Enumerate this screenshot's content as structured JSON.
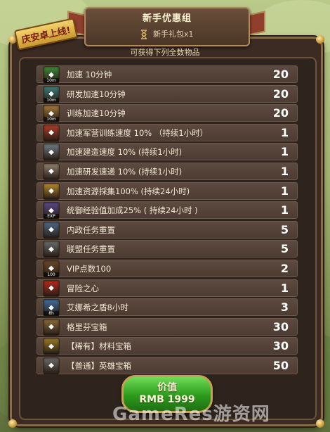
{
  "banner": {
    "title": "新手优惠组",
    "pack_label": "新手礼包x1"
  },
  "badge": "庆安卓上线!",
  "caption": "可获得下列全数物品",
  "items": [
    {
      "name": "加速 10分钟",
      "qty": "20",
      "icon": "speedup-icon",
      "icon_text": "10m",
      "color": "#3f8a3a"
    },
    {
      "name": "研发加速10分钟",
      "qty": "20",
      "icon": "research-speedup-icon",
      "icon_text": "10m",
      "color": "#3a7f7a"
    },
    {
      "name": "训练加速10分钟",
      "qty": "20",
      "icon": "training-speedup-icon",
      "icon_text": "10m",
      "color": "#a67a3a"
    },
    {
      "name": "加速军营训练速度 10% （持续1小时）",
      "qty": "1",
      "icon": "barracks-boost-icon",
      "icon_text": "",
      "color": "#b23b2c"
    },
    {
      "name": "加速建造速度  10%   (持续1小时)",
      "qty": "1",
      "icon": "build-boost-icon",
      "icon_text": "",
      "color": "#6f7d88"
    },
    {
      "name": "加速研发速递  10%   (持续1小时)",
      "qty": "1",
      "icon": "research-boost-icon",
      "icon_text": "",
      "color": "#8e8270"
    },
    {
      "name": "加速资源採集100%  (持续24小时)",
      "qty": "1",
      "icon": "gather-boost-icon",
      "icon_text": "",
      "color": "#b58a2f"
    },
    {
      "name": "统御经验值加成25% ( 持续24小时 )",
      "qty": "1",
      "icon": "exp-boost-icon",
      "icon_text": "EXP",
      "color": "#5a4a8a"
    },
    {
      "name": "内政任务重置",
      "qty": "5",
      "icon": "domestic-quest-reset-icon",
      "icon_text": "",
      "color": "#4d6a8a"
    },
    {
      "name": "联盟任务重置",
      "qty": "5",
      "icon": "alliance-quest-reset-icon",
      "icon_text": "",
      "color": "#6b6b6b"
    },
    {
      "name": "VIP点数100",
      "qty": "2",
      "icon": "vip-points-icon",
      "icon_text": "100",
      "color": "#6a4a28"
    },
    {
      "name": "冒险之心",
      "qty": "1",
      "icon": "heart-icon",
      "icon_text": "",
      "color": "#b8281c"
    },
    {
      "name": "艾娜希之盾8小时",
      "qty": "3",
      "icon": "shield-icon",
      "icon_text": "8h",
      "color": "#3e6ea0"
    },
    {
      "name": "格里芬宝箱",
      "qty": "30",
      "icon": "griffin-chest-icon",
      "icon_text": "",
      "color": "#8a6a3a"
    },
    {
      "name": "【稀有】材料宝箱",
      "qty": "30",
      "icon": "material-chest-icon",
      "icon_text": "",
      "color": "#9a7a2a"
    },
    {
      "name": "【普通】英雄宝箱",
      "qty": "50",
      "icon": "hero-chest-icon",
      "icon_text": "",
      "color": "#6a6a6a"
    }
  ],
  "price": {
    "label": "价值",
    "value": "RMB 1999"
  },
  "watermark": "GameRes游资网"
}
